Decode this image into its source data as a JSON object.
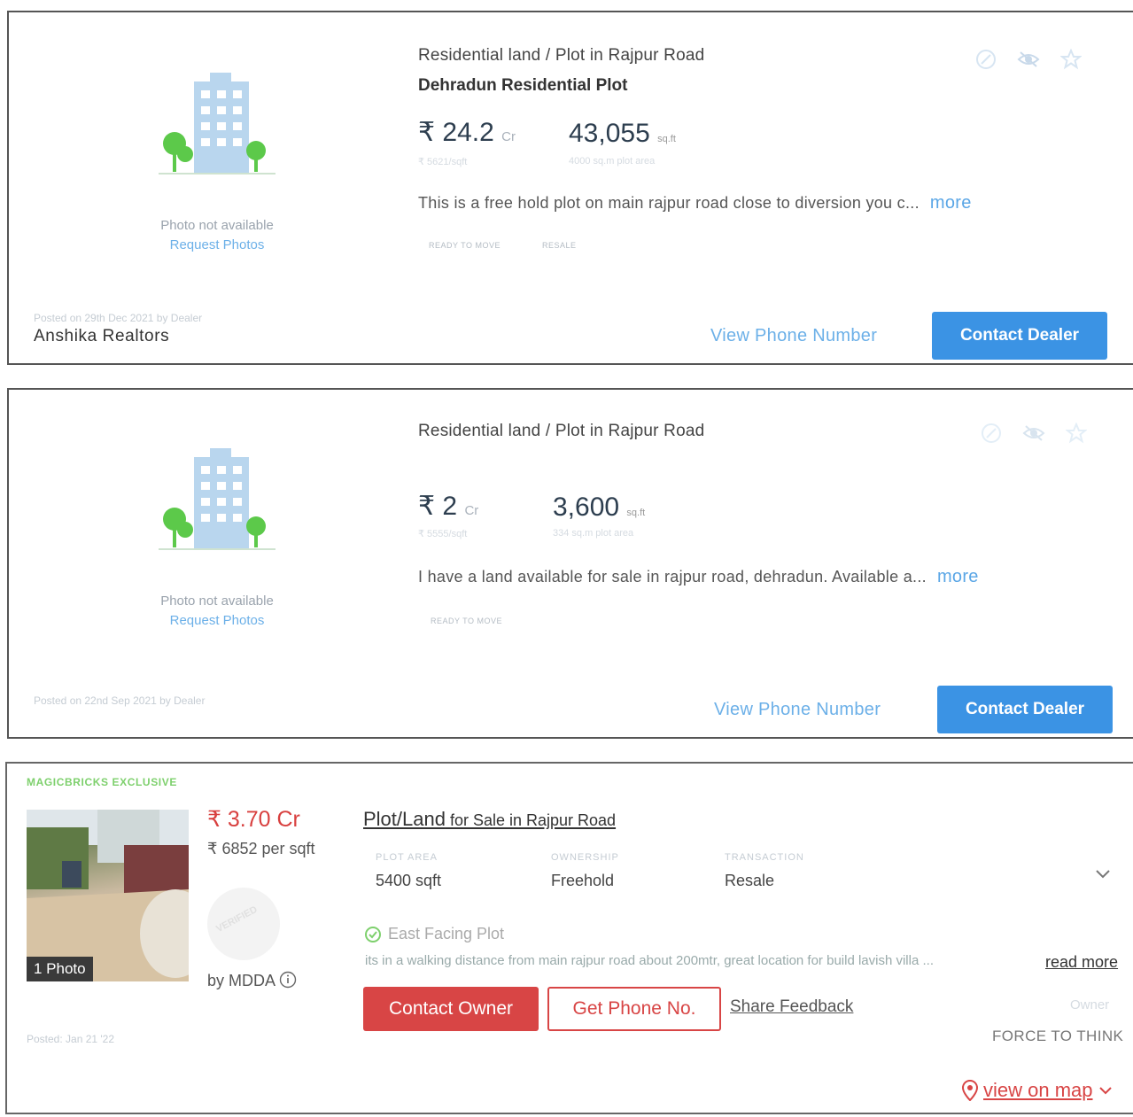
{
  "listings": [
    {
      "photo_placeholder": "Photo not available",
      "request_photos": "Request Photos",
      "type": "Residential land / Plot in Rajpur Road",
      "name": "Dehradun Residential Plot",
      "price": "₹ 24.2",
      "price_suffix": "Cr",
      "price_sub": "₹ 5621/sqft",
      "area": "43,055",
      "area_unit": "sq.ft",
      "area_sub": "4000 sq.m plot area",
      "description": "This is a free hold plot on main rajpur road close to diversion you c...",
      "more": "more",
      "tags": [
        "READY TO MOVE",
        "RESALE"
      ],
      "posted": "Posted on 29th Dec 2021 by Dealer",
      "dealer": "Anshika Realtors",
      "view_phone": "View Phone Number",
      "contact": "Contact Dealer",
      "icons": [
        "share-icon",
        "hide-icon",
        "star-icon"
      ]
    },
    {
      "photo_placeholder": "Photo not available",
      "request_photos": "Request Photos",
      "type": "Residential land / Plot in Rajpur Road",
      "price": "₹ 2",
      "price_suffix": "Cr",
      "price_sub": "₹ 5555/sqft",
      "area": "3,600",
      "area_unit": "sq.ft",
      "area_sub": "334 sq.m plot area",
      "description": "I have a land available for sale in rajpur road, dehradun. Available a...",
      "more": "more",
      "tags": [
        "READY TO MOVE"
      ],
      "posted": "Posted on 22nd Sep 2021 by Dealer",
      "view_phone": "View Phone Number",
      "contact": "Contact Dealer",
      "icons": [
        "share-icon",
        "hide-icon",
        "star-icon"
      ]
    }
  ],
  "exclusive": {
    "badge": "MAGICBRICKS EXCLUSIVE",
    "photo_count": "1 Photo",
    "price": "₹ 3.70 Cr",
    "price_per_sqft": "₹ 6852 per sqft",
    "stamp": "VERIFIED",
    "approved_by": "by MDDA",
    "posted": "Posted: Jan 21 '22",
    "title_main": "Plot/Land",
    "title_rest": " for Sale in Rajpur Road",
    "summary": [
      {
        "label": "PLOT AREA",
        "value": "5400 sqft"
      },
      {
        "label": "OWNERSHIP",
        "value": "Freehold"
      },
      {
        "label": "TRANSACTION",
        "value": "Resale"
      }
    ],
    "facing": "East Facing Plot",
    "description": "its in a walking distance from main rajpur road about 200mtr, great location for build lavish villa ...",
    "read_more": "read more",
    "contact_owner": "Contact Owner",
    "get_phone": "Get Phone No.",
    "share_feedback": "Share Feedback",
    "owner_label": "Owner",
    "owner_name": "FORCE TO THINK",
    "view_on_map": "view on map"
  },
  "colors": {
    "primary_blue": "#3b93e4",
    "link_blue": "#6cb0e8",
    "accent_red": "#d84545",
    "exclusive_green": "#7ed06d"
  }
}
